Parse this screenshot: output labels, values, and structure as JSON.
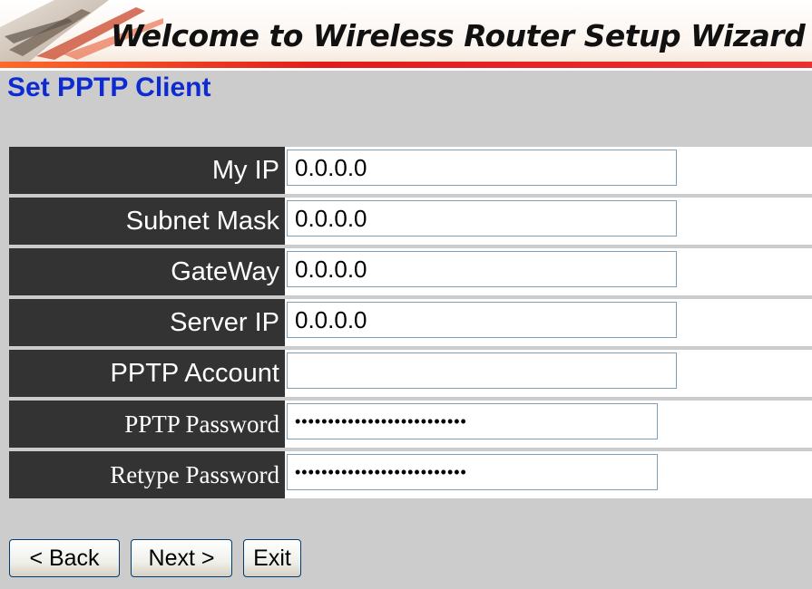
{
  "banner": {
    "title": "Welcome to Wireless Router Setup Wizard"
  },
  "page": {
    "title": "Set PPTP Client"
  },
  "form": {
    "my_ip": {
      "label": "My IP",
      "value": "0.0.0.0"
    },
    "subnet_mask": {
      "label": "Subnet Mask",
      "value": "0.0.0.0"
    },
    "gateway": {
      "label": "GateWay",
      "value": "0.0.0.0"
    },
    "server_ip": {
      "label": "Server IP",
      "value": "0.0.0.0"
    },
    "pptp_account": {
      "label": "PPTP Account",
      "value": ""
    },
    "pptp_password": {
      "label": "PPTP Password",
      "value": "••••••••••••••••••••••••••"
    },
    "retype_password": {
      "label": "Retype Password",
      "value": "••••••••••••••••••••••••••"
    }
  },
  "buttons": {
    "back": "< Back",
    "next": "Next >",
    "exit": "Exit"
  },
  "colors": {
    "title": "#0d2bd0",
    "label_bg": "#333333",
    "background": "#cccccc",
    "accent_line": "#e31b1b"
  },
  "icons": {
    "banner_decoration": "brush-stroke-logo"
  }
}
